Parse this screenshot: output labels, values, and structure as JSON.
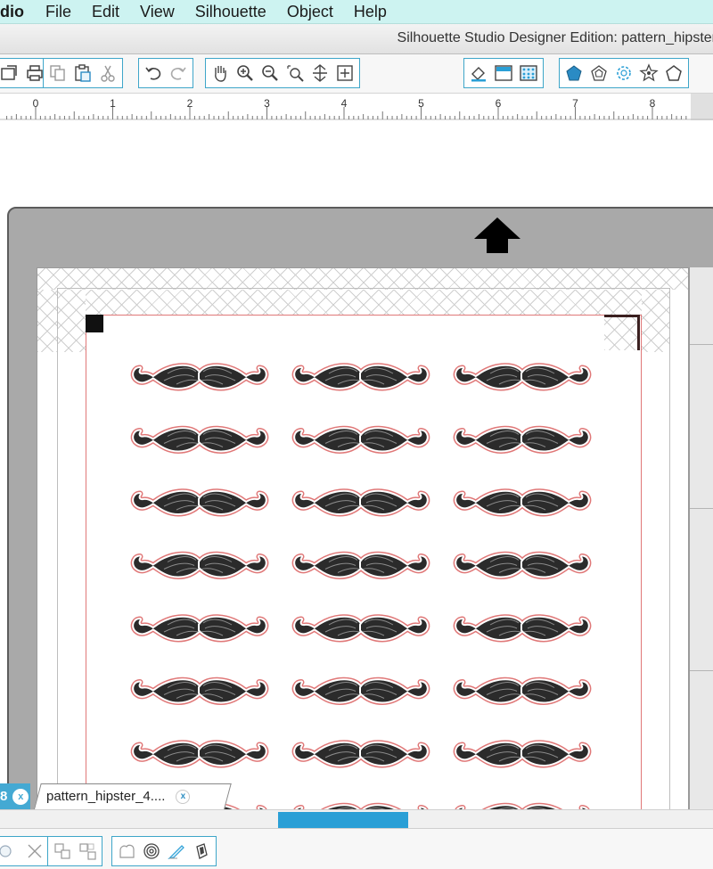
{
  "menubar": {
    "app_label": "dio",
    "items": [
      "File",
      "Edit",
      "View",
      "Silhouette",
      "Object",
      "Help"
    ]
  },
  "window": {
    "title": "Silhouette Studio Designer Edition: pattern_hipster"
  },
  "toolbar": {
    "left_group_1": [
      "send-icon",
      "print-icon"
    ],
    "edit_group": [
      "copy-icon",
      "paste-icon",
      "cut-icon"
    ],
    "history_group": [
      "undo-icon",
      "redo-icon"
    ],
    "view_group": [
      "pan-hand-icon",
      "zoom-in-icon",
      "zoom-out-icon",
      "zoom-select-icon",
      "fit-to-window-icon",
      "zoom-to-page-icon"
    ],
    "panel_group_1": [
      "fill-icon",
      "line-color-icon",
      "fill-pattern-icon"
    ],
    "panel_group_2": [
      "shape-pentagon-icon",
      "shape-rounded-icon",
      "shape-flower-icon",
      "shape-star-icon",
      "shape-outline-icon"
    ]
  },
  "ruler": {
    "labels": [
      "0",
      "1",
      "2",
      "3",
      "4",
      "5",
      "6",
      "7",
      "8"
    ]
  },
  "document": {
    "mustache_rows": 8,
    "mustache_cols": 3
  },
  "tabs": {
    "left_tab_label": "8",
    "active_tab_label": "pattern_hipster_4....",
    "close_label": "x"
  },
  "scrollbar": {
    "position_fraction": 0.39
  },
  "bottom_toolbar": {
    "items": [
      "ungroup-icon",
      "delete-icon",
      "group-icon",
      "release-icon",
      "weld-icon",
      "offset-icon",
      "knife-icon",
      "eraser-icon"
    ]
  },
  "colors": {
    "accent": "#2a9fd6",
    "menubar": "#cdf3f1",
    "cut_line": "#e07878",
    "mustache": "#2b2b2b"
  }
}
